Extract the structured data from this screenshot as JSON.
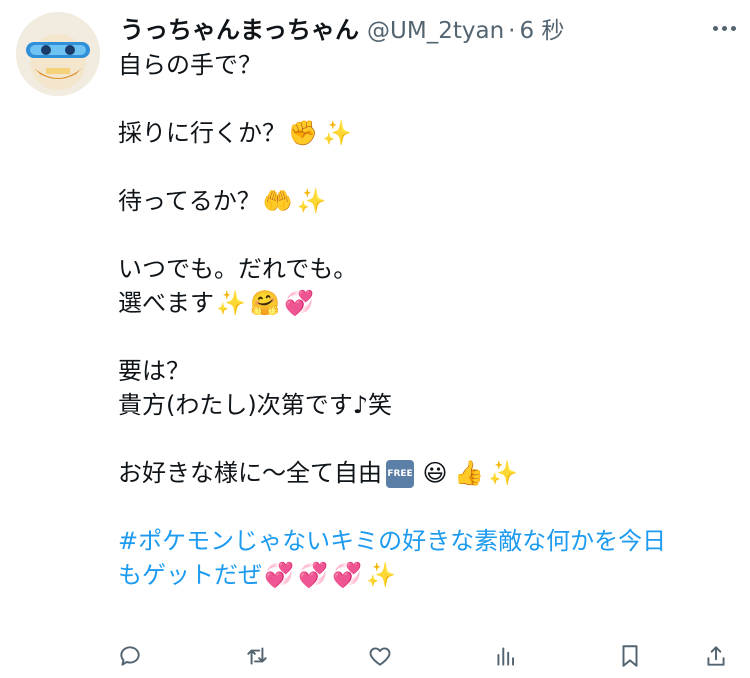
{
  "user": {
    "display_name": "うっちゃんまっちゃん",
    "handle": "@UM_2tyan",
    "separator": "·",
    "time": "6 秒"
  },
  "lines": [
    {
      "text": "自らの手で？",
      "emoji": []
    },
    {
      "text": "",
      "emoji": []
    },
    {
      "text": "採りに行くか？",
      "emoji": [
        "✊",
        "✨"
      ]
    },
    {
      "text": "",
      "emoji": []
    },
    {
      "text": "待ってるか？",
      "emoji": [
        "🤲",
        "✨"
      ]
    },
    {
      "text": "",
      "emoji": []
    },
    {
      "text": "いつでも。だれでも。",
      "emoji": []
    },
    {
      "text": "選べます",
      "emoji": [
        "✨",
        "🤗",
        "💞"
      ]
    },
    {
      "text": "",
      "emoji": []
    },
    {
      "text": "要は？",
      "emoji": []
    },
    {
      "text": "貴方(わたし)次第です♪笑",
      "emoji": []
    },
    {
      "text": "",
      "emoji": []
    },
    {
      "text": "お好きな様に〜全て自由",
      "emoji": [
        "🆓",
        "😃",
        "👍",
        "✨"
      ]
    },
    {
      "text": "",
      "emoji": []
    },
    {
      "text": "#ポケモンじゃないキミの好きな素敵な何かを今日",
      "emoji": [],
      "hashtag": true
    },
    {
      "text": "もゲットだぜ",
      "emoji": [
        "💞",
        "💞",
        "💞",
        "✨"
      ],
      "hashtag": true
    }
  ],
  "free_badge": "FREE",
  "icons": {
    "avatar": "avatar-image",
    "more": "more-icon",
    "reply": "reply-icon",
    "retweet": "retweet-icon",
    "like": "heart-icon",
    "views": "views-icon",
    "bookmark": "bookmark-icon",
    "share": "share-icon"
  },
  "colors": {
    "text": "#0f1419",
    "secondary": "#536471",
    "hashtag": "#1d9bf0"
  }
}
